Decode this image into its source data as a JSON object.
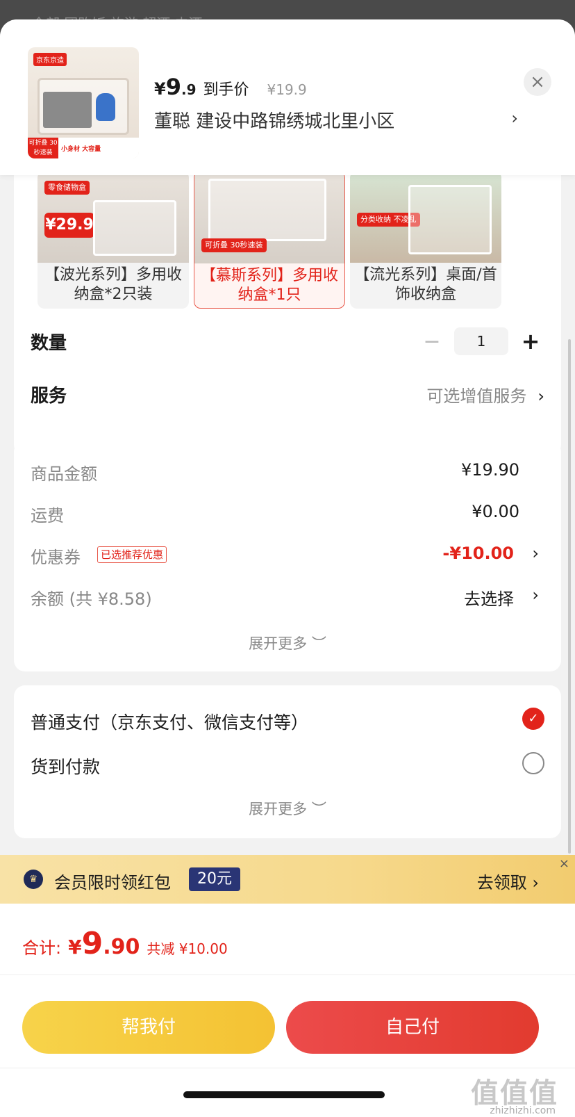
{
  "header": {
    "price_yen": "¥",
    "price_int": "9",
    "price_dec": ".9",
    "price_label": "到手价",
    "original_price": "¥19.9",
    "address": "董聪  建设中路锦绣城北里小区",
    "address_arrow": "›",
    "close_icon": "×",
    "thumb_tag": "京东京造",
    "thumb_badge": "可折叠 30秒速装",
    "thumb_text": "小身材 大容量"
  },
  "variants": [
    {
      "label": "【波光系列】多用收纳盒*2只装",
      "sticker": "零食储物盒",
      "price": "¥29.9",
      "selected": false
    },
    {
      "label": "【慕斯系列】多用收纳盒*1只",
      "sticker": "可折叠 30秒速装",
      "selected": true
    },
    {
      "label": "【流光系列】桌面/首饰收纳盒",
      "sticker": "分类收纳 不凌乱",
      "selected": false
    }
  ],
  "quantity": {
    "title": "数量",
    "minus": "−",
    "value": "1",
    "plus": "+"
  },
  "service": {
    "title": "服务",
    "value": "可选增值服务",
    "arrow": "›"
  },
  "price_card": {
    "goods_label": "商品金额",
    "goods_value": "¥19.90",
    "shipping_label": "运费",
    "shipping_value": "¥0.00",
    "coupon_label": "优惠券",
    "coupon_tag": "已选推荐优惠",
    "coupon_value": "-¥10.00",
    "balance_label": "余额 (共 ¥8.58)",
    "balance_value": "去选择",
    "arrow": "›",
    "expand": "展开更多 ︶"
  },
  "payment": {
    "normal": "普通支付（京东支付、微信支付等）",
    "cod": "货到付款",
    "expand": "展开更多 ︶",
    "check": "✓"
  },
  "banner": {
    "icon": "♛",
    "text": "会员限时领红包",
    "badge": "20元",
    "action": "去领取 ›",
    "close": "×"
  },
  "total": {
    "label": "合计:",
    "yen": "¥",
    "int": "9",
    "dec": ".90",
    "cut": "共减 ¥10.00"
  },
  "buttons": {
    "help": "帮我付",
    "self": "自己付"
  },
  "watermark": {
    "text": "值值值",
    "sub": "zhizhizhi.com"
  },
  "bg_tabs": "全部      团购饭      旅游      超酒      去酒",
  "colors": {
    "accent": "#e2231a",
    "help_button": "#f4c233",
    "self_button": "#e23b2f",
    "banner": "#f6d98c"
  }
}
